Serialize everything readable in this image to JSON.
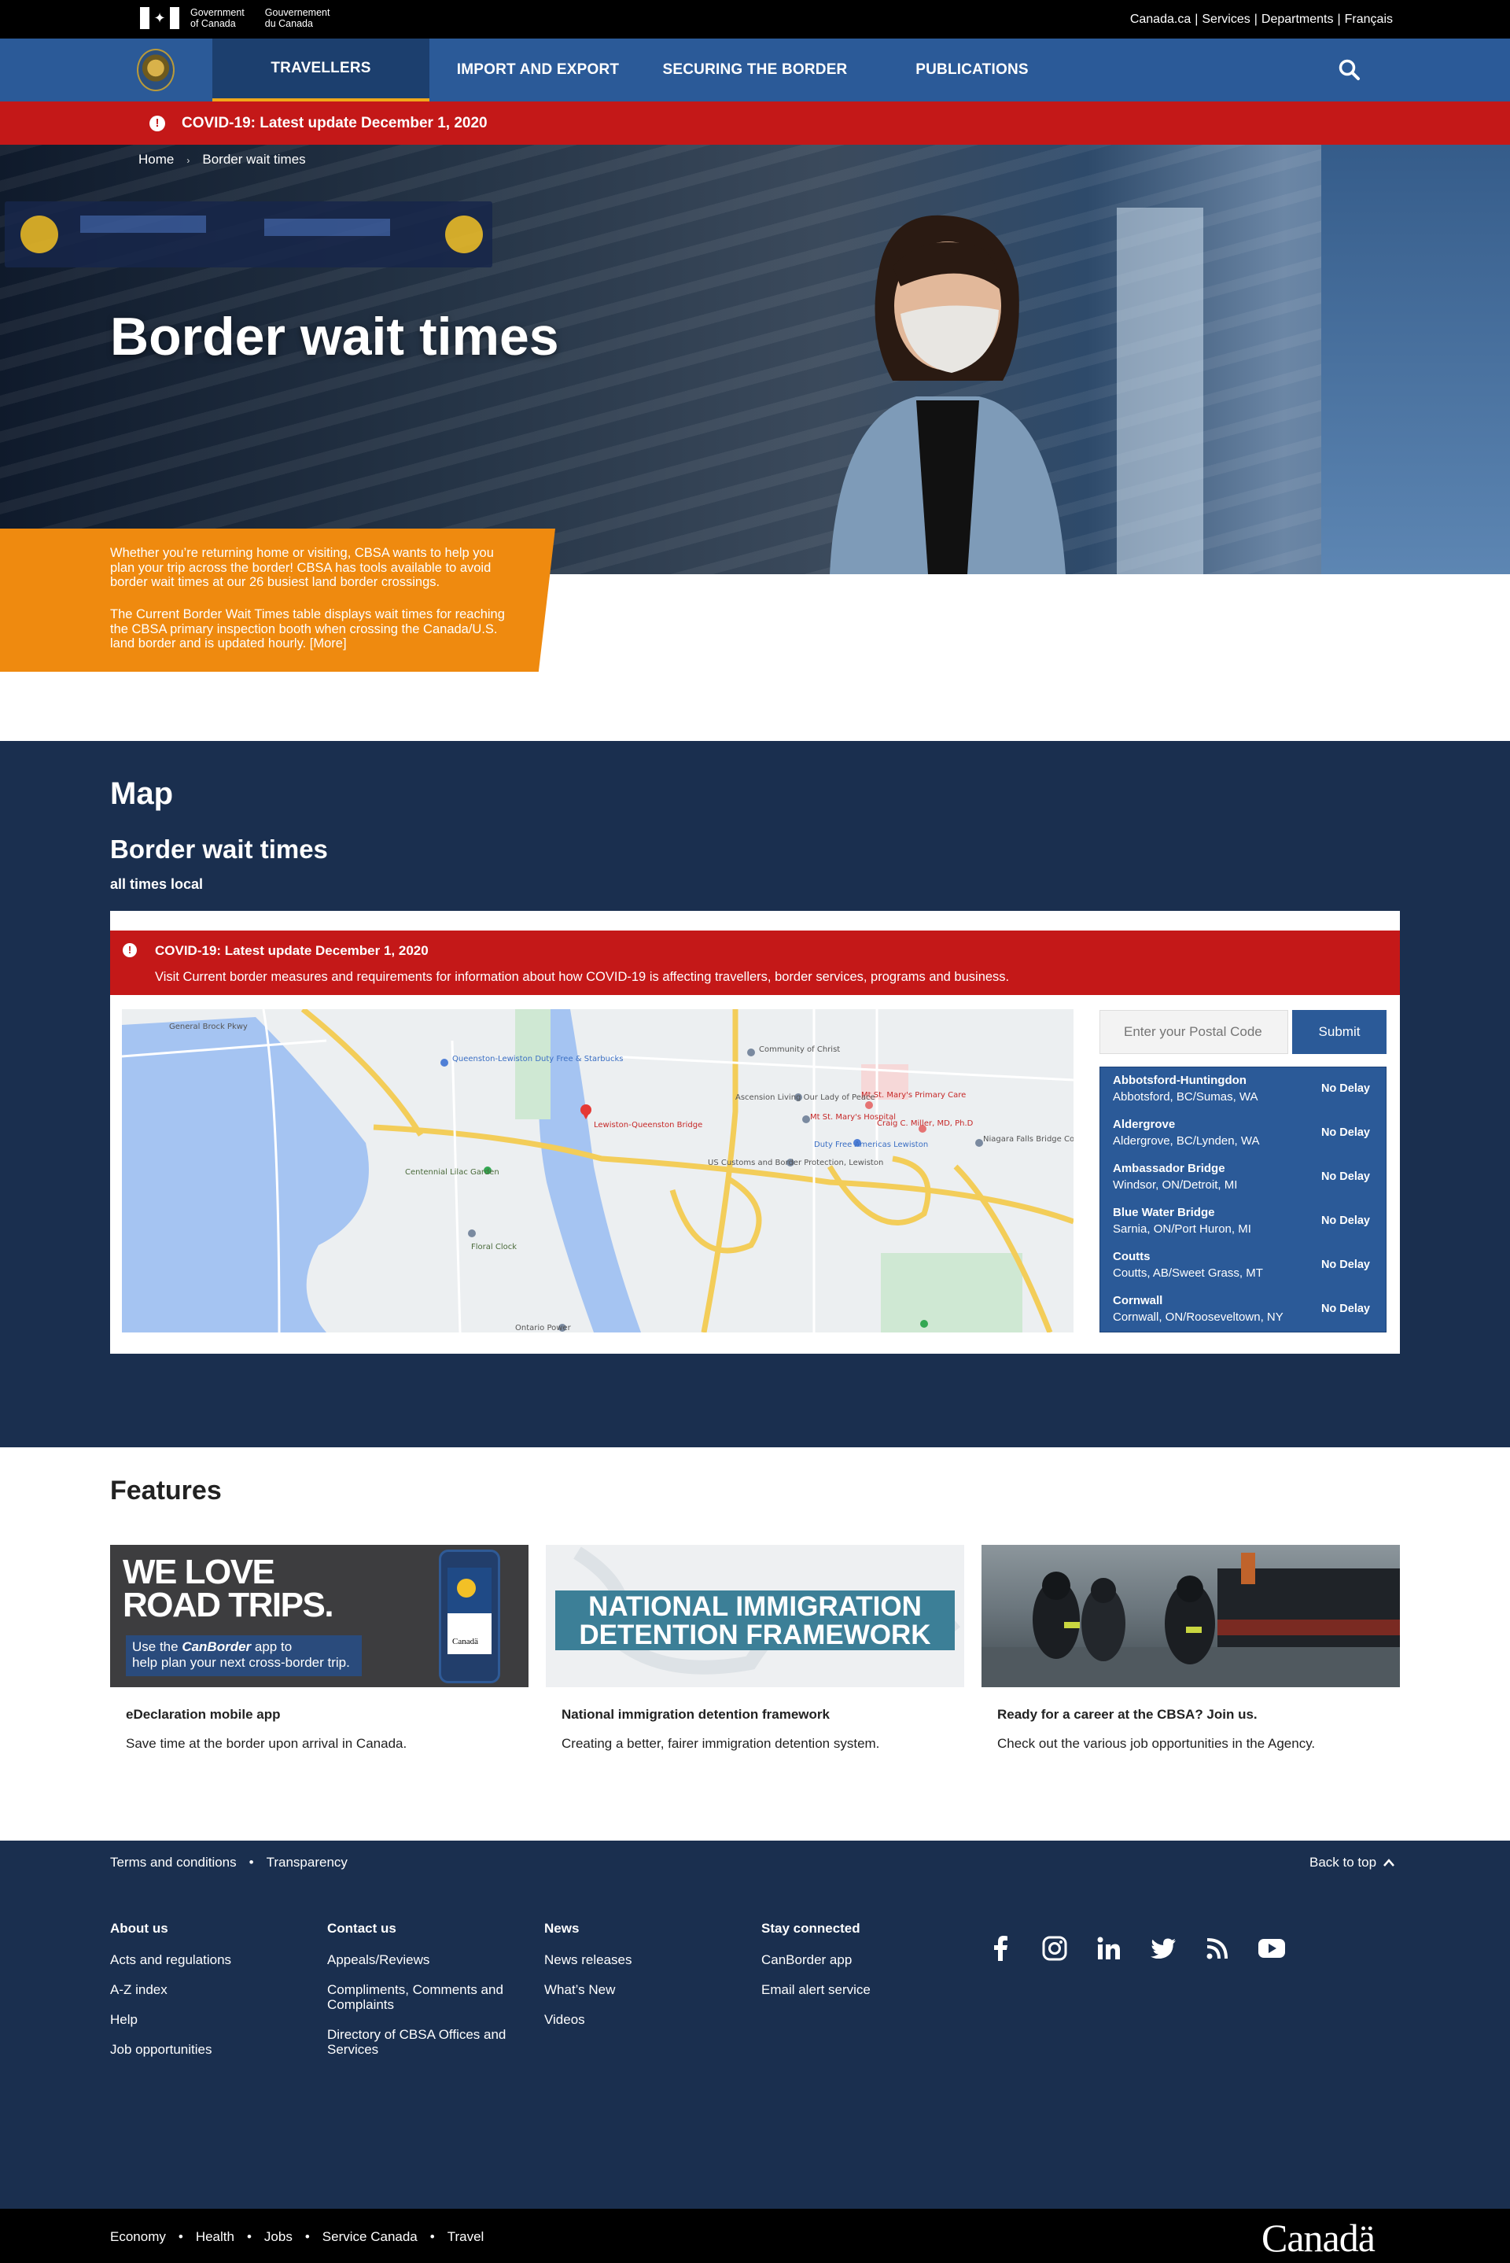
{
  "gov": {
    "name_en_1": "Government",
    "name_en_2": "of Canada",
    "name_fr_1": "Gouvernement",
    "name_fr_2": "du Canada",
    "links": [
      "Canada.ca",
      "Services",
      "Departments",
      "Français"
    ]
  },
  "nav": {
    "items": [
      "TRAVELLERS",
      "IMPORT AND EXPORT",
      "SECURING THE BORDER",
      "PUBLICATIONS"
    ],
    "active_index": 0
  },
  "covid_banner": "COVID-19: Latest update December 1, 2020",
  "breadcrumb": [
    "Home",
    "Border wait times"
  ],
  "hero": {
    "title": "Border wait times"
  },
  "intro": {
    "p1": "Whether you’re returning home or visiting, CBSA wants to help you plan your trip across the border! CBSA has tools available to avoid border wait times at our 26 busiest land border crossings.",
    "p2": "The Current Border Wait Times table displays wait times for reaching the CBSA primary inspection booth when crossing the Canada/U.S. land border and is updated hourly. [More]"
  },
  "map_section": {
    "heading": "Map",
    "subheading": "Border wait times",
    "note": "all times local",
    "alert_title": "COVID-19: Latest update December 1, 2020",
    "alert_body": "Visit Current border measures and requirements for information about how COVID-19 is affecting travellers, border services, programs and business.",
    "postal_placeholder": "Enter your Postal Code",
    "submit_label": "Submit",
    "map_labels": {
      "queenston": "Queenston-Lewiston Duty Free & Starbucks",
      "bridge": "Lewiston-Queenston Bridge",
      "lilac": "Centennial Lilac Garden",
      "customs": "US Customs and Border Protection, Lewiston",
      "dutyfree": "Duty Free Americas Lewiston",
      "church": "Community of Christ",
      "stmary": "Mt St. Mary's Hospital",
      "primary": "Mt St. Mary's Primary Care",
      "miller": "Craig C. Miller, MD, Ph.D",
      "ascension": "Ascension Living Our Lady of Peace",
      "floral": "Floral Clock",
      "niagara_bridge": "Niagara Falls Bridge Commission",
      "ontario_power": "Ontario Power",
      "gp_rd": "General Brock Pkwy"
    },
    "crossings": [
      {
        "name": "Abbotsford-Huntingdon",
        "location": "Abbotsford, BC/Sumas, WA",
        "delay": "No Delay"
      },
      {
        "name": "Aldergrove",
        "location": "Aldergrove, BC/Lynden, WA",
        "delay": "No Delay"
      },
      {
        "name": "Ambassador Bridge",
        "location": "Windsor, ON/Detroit, MI",
        "delay": "No Delay"
      },
      {
        "name": "Blue Water Bridge",
        "location": "Sarnia, ON/Port Huron, MI",
        "delay": "No Delay"
      },
      {
        "name": "Coutts",
        "location": "Coutts, AB/Sweet Grass, MT",
        "delay": "No Delay"
      },
      {
        "name": "Cornwall",
        "location": "Cornwall, ON/Rooseveltown, NY",
        "delay": "No Delay"
      }
    ]
  },
  "features": {
    "heading": "Features",
    "cards": [
      {
        "title": "eDeclaration mobile app",
        "desc": "Save time at the border upon arrival in Canada.",
        "img_line1": "WE LOVE",
        "img_line2": "ROAD TRIPS.",
        "img_sub_pre": "Use the ",
        "img_sub_bold": "CanBorder",
        "img_sub_post": " app to",
        "img_sub2": "help plan your next cross-border trip.",
        "img_phone_word": "Canadä"
      },
      {
        "title": "National immigration detention framework",
        "desc": "Creating a better, fairer immigration detention system.",
        "img_line1": "NATIONAL IMMIGRATION",
        "img_line2": "DETENTION FRAMEWORK"
      },
      {
        "title": "Ready for a career at the CBSA? Join us.",
        "desc": "Check out the various job opportunities in the Agency."
      }
    ]
  },
  "footer": {
    "top_links": [
      "Terms and conditions",
      "Transparency"
    ],
    "back_to_top": "Back to top",
    "columns": [
      {
        "heading": "About us",
        "items": [
          "Acts and regulations",
          "A-Z index",
          "Help",
          "Job opportunities"
        ]
      },
      {
        "heading": "Contact us",
        "items": [
          "Appeals/Reviews",
          "Compliments, Comments and Complaints",
          "Directory of CBSA Offices and Services"
        ]
      },
      {
        "heading": "News",
        "items": [
          "News releases",
          "What’s New",
          "Videos"
        ]
      },
      {
        "heading": "Stay connected",
        "items": [
          "CanBorder app",
          "Email alert service"
        ]
      }
    ],
    "socials": [
      "facebook-icon",
      "instagram-icon",
      "linkedin-icon",
      "twitter-icon",
      "rss-icon",
      "youtube-icon"
    ],
    "bottom_links": [
      "Economy",
      "Health",
      "Jobs",
      "Service Canada",
      "Travel"
    ],
    "wordmark": "Canadä"
  }
}
